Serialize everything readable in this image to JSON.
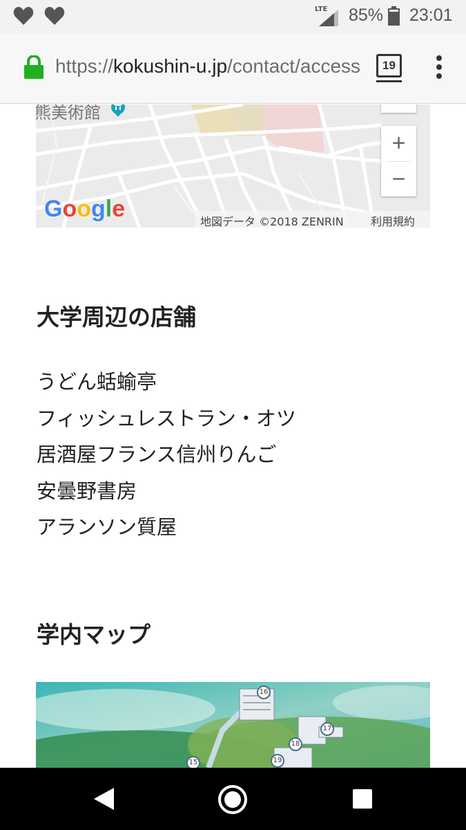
{
  "status_bar": {
    "network": "LTE",
    "battery": "85%",
    "time": "23:01"
  },
  "browser": {
    "url_scheme": "https://",
    "url_host": "kokushin-u.jp",
    "url_path": "/contact/access",
    "tab_count": "19"
  },
  "map": {
    "place_label": "熊美術館",
    "zoom_in": "+",
    "zoom_out": "−",
    "provider": "Google",
    "data_credit": "地図データ ©2018 ZENRIN",
    "terms": "利用規約"
  },
  "shops_section": {
    "title": "大学周辺の店舗",
    "items": [
      "うどん蛞蝓亭",
      "フィッシュレストラン・オツ",
      "居酒屋フランス信州りんご",
      "安曇野書房",
      "アランソン質屋"
    ]
  },
  "campus_section": {
    "title": "学内マップ",
    "markers": [
      "15",
      "16",
      "17",
      "18",
      "19"
    ]
  },
  "colors": {
    "lock": "#1fb01f",
    "status_icons": "#555555",
    "text": "#222222",
    "map_building_pink": "#f1d6d6",
    "map_park_tan": "#eadfb8"
  }
}
